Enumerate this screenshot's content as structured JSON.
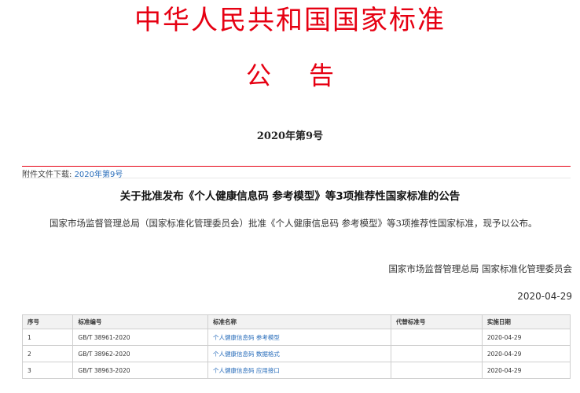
{
  "header": {
    "title": "中华人民共和国国家标准",
    "notice_char1": "公",
    "notice_char2": "告",
    "issue": "2020年第9号"
  },
  "attachment": {
    "label": "附件文件下载:",
    "link": "2020年第9号"
  },
  "document": {
    "title": "关于批准发布《个人健康信息码 参考模型》等3项推荐性国家标准的公告",
    "body": "国家市场监督管理总局（国家标准化管理委员会）批准《个人健康信息码 参考模型》等3项推荐性国家标准，现予以公布。",
    "signer": "国家市场监督管理总局 国家标准化管理委员会",
    "date": "2020-04-29"
  },
  "table": {
    "headers": [
      "序号",
      "标准编号",
      "标准名称",
      "代替标准号",
      "实施日期"
    ],
    "rows": [
      {
        "no": "1",
        "code": "GB/T 38961-2020",
        "name": "个人健康信息码 参考模型",
        "replace": "",
        "date": "2020-04-29"
      },
      {
        "no": "2",
        "code": "GB/T 38962-2020",
        "name": "个人健康信息码 数据格式",
        "replace": "",
        "date": "2020-04-29"
      },
      {
        "no": "3",
        "code": "GB/T 38963-2020",
        "name": "个人健康信息码 应用接口",
        "replace": "",
        "date": "2020-04-29"
      }
    ]
  }
}
